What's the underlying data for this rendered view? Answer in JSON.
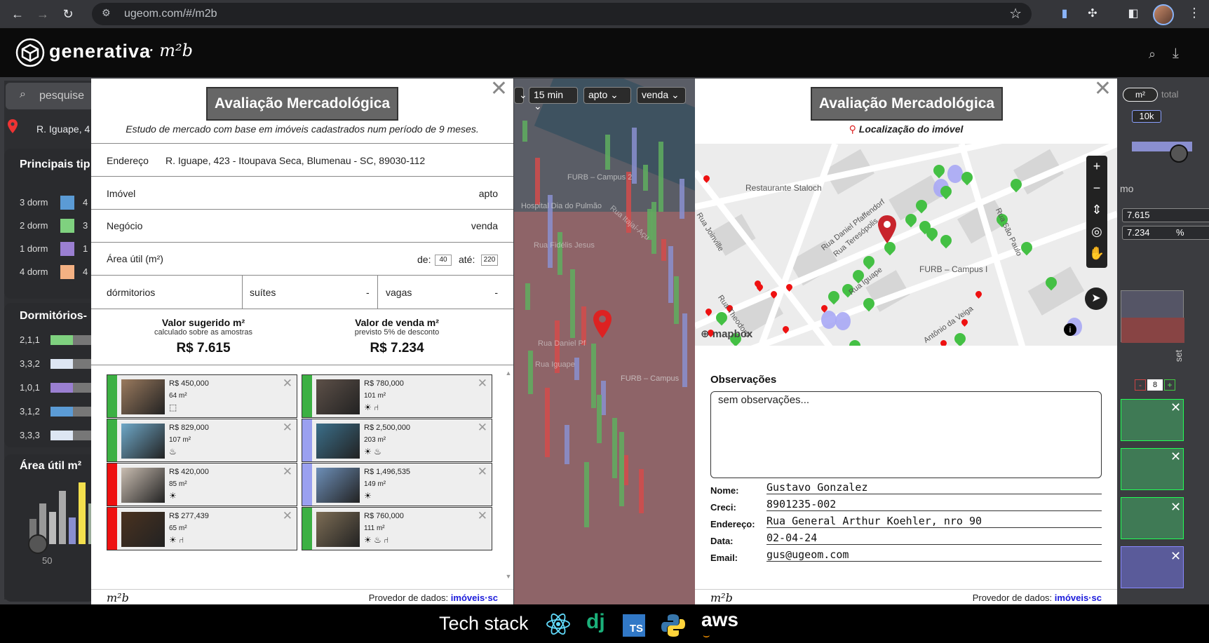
{
  "browser": {
    "url": "ugeom.com/#/m2b"
  },
  "app": {
    "brand": "generativa",
    "brand_sub": "· m²b"
  },
  "left_panel": {
    "search_placeholder": "pesquise",
    "address": "R. Iguape, 4",
    "tipologias_title": "Principais tip",
    "tipologias": [
      {
        "label": "3 dorm",
        "value": "4",
        "color": "#5b9bd5"
      },
      {
        "label": "2 dorm",
        "value": "3",
        "color": "#7fd17f"
      },
      {
        "label": "1 dorm",
        "value": "1",
        "color": "#9a7fd1"
      },
      {
        "label": "4 dorm",
        "value": "4",
        "color": "#f4b183"
      }
    ],
    "dormitorios_title": "Dormitórios-",
    "dormitorios": [
      {
        "label": "2,1,1",
        "color": "#7fd17f"
      },
      {
        "label": "3,3,2",
        "color": "#dde6f3"
      },
      {
        "label": "1,0,1",
        "color": "#9a7fd1"
      },
      {
        "label": "3,1,2",
        "color": "#5b9bd5"
      },
      {
        "label": "3,3,3",
        "color": "#dde6f3"
      }
    ],
    "area_title": "Área útil m²",
    "area_tick": "50"
  },
  "map_toolbar": {
    "time": "15 min",
    "tipo": "apto",
    "negocio": "venda"
  },
  "map_labels": [
    "FURB – Campus 2",
    "Hospital Dia do Pulmão",
    "Rua Itajaí-Açu",
    "Rua Fidélis Jesus",
    "Rua Iguape",
    "FURB – Campus",
    "Rua Daniel Pf"
  ],
  "right_panel": {
    "unit_m2": "m²",
    "unit_total": "total",
    "slider_val": "10k",
    "val1": "7.615",
    "val2": "7.234",
    "pct": "%",
    "stepper_value": "8",
    "stepper_minus": "-",
    "stepper_plus": "+",
    "mo": "mo",
    "set": "set"
  },
  "modal_left": {
    "title": "Avaliação Mercadológica",
    "subtitle": "Estudo de mercado com base em imóveis cadastrados num período de 9 meses.",
    "endereco_label": "Endereço",
    "endereco_value": "R. Iguape, 423 - Itoupava Seca, Blumenau - SC, 89030-112",
    "imovel_label": "Imóvel",
    "imovel_value": "apto",
    "negocio_label": "Negócio",
    "negocio_value": "venda",
    "area_label": "Área útil (m²)",
    "de_label": "de:",
    "de_value": "40",
    "ate_label": "até:",
    "ate_value": "220",
    "dorm_label": "dórmitorios",
    "suites_label": "suítes",
    "suites_value": "-",
    "vagas_label": "vagas",
    "vagas_value": "-",
    "sug_title": "Valor sugerido m²",
    "sug_sub": "calculado sobre as amostras",
    "sug_value": "R$ 7.615",
    "venda_title": "Valor de venda m²",
    "venda_sub": "previsto 5% de desconto",
    "venda_value": "R$ 7.234",
    "cards": [
      {
        "price": "R$ 450,000",
        "area": "64 m²",
        "icons": "⬚",
        "strip": "#3cb043",
        "thumb": "#9a7a5e"
      },
      {
        "price": "R$ 780,000",
        "area": "101 m²",
        "icons": "☀ ⑁",
        "strip": "#3cb043",
        "thumb": "#5d5048"
      },
      {
        "price": "R$ 829,000",
        "area": "107 m²",
        "icons": "♨",
        "strip": "#3cb043",
        "thumb": "#6fa8c8"
      },
      {
        "price": "R$ 2,500,000",
        "area": "203 m²",
        "icons": "☀ ♨",
        "strip": "#9aa0f0",
        "thumb": "#3b6f8a"
      },
      {
        "price": "R$ 420,000",
        "area": "85 m²",
        "icons": "☀",
        "strip": "#ee1111",
        "thumb": "#c9bdb1"
      },
      {
        "price": "R$ 1,496,535",
        "area": "149 m²",
        "icons": "☀",
        "strip": "#9aa0f0",
        "thumb": "#6d8fb8"
      },
      {
        "price": "R$ 277,439",
        "area": "65 m²",
        "icons": "☀ ⑁",
        "strip": "#ee1111",
        "thumb": "#4a3220"
      },
      {
        "price": "R$ 760,000",
        "area": "111 m²",
        "icons": "☀ ♨ ⑁",
        "strip": "#3cb043",
        "thumb": "#7d6d55"
      }
    ],
    "footer_logo": "m²b",
    "provider_label": "Provedor de dados:",
    "provider_name": "imóveis·sc"
  },
  "modal_right": {
    "title": "Avaliação Mercadológica",
    "subtitle": "Localização do imóvel",
    "map_labels": [
      "Restaurante Staloch",
      "Rua Daniel Pfaffendorf",
      "Rua Joinville",
      "Rua Teresópolis",
      "Rua Iguape",
      "FURB – Campus I",
      "Rua São Paulo",
      "Rua Theodoro",
      "Antônio da Veiga"
    ],
    "mapbox": "mapbox",
    "obs_title": "Observações",
    "obs_value": "sem observações...",
    "fields": [
      {
        "label": "Nome:",
        "value": "Gustavo Gonzalez"
      },
      {
        "label": "Creci:",
        "value": "8901235-002"
      },
      {
        "label": "Endereço:",
        "value": "Rua General Arthur Koehler, nro 90"
      },
      {
        "label": "Data:",
        "value": "02-04-24"
      },
      {
        "label": "Email:",
        "value": "gus@ugeom.com"
      }
    ],
    "footer_logo": "m²b",
    "provider_label": "Provedor de dados:",
    "provider_name": "imóveis·sc"
  },
  "techbar": {
    "label": "Tech stack",
    "items": [
      "react",
      "dj",
      "TS",
      "python",
      "aws"
    ]
  }
}
